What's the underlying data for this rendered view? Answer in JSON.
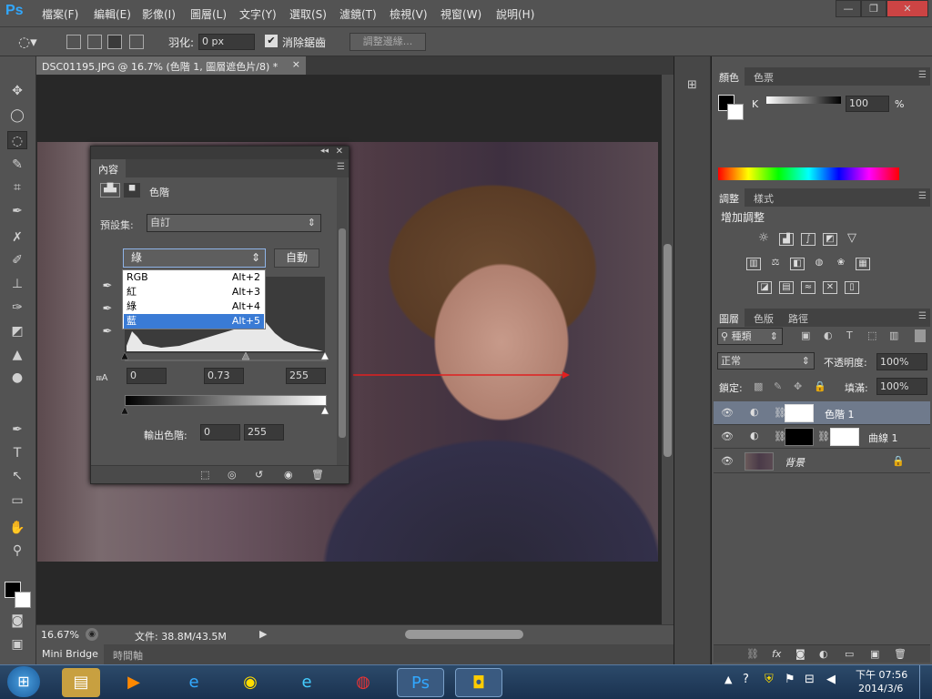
{
  "app": {
    "logo": "Ps",
    "menu": [
      "檔案(F)",
      "編輯(E)",
      "影像(I)",
      "圖層(L)",
      "文字(Y)",
      "選取(S)",
      "濾鏡(T)",
      "檢視(V)",
      "視窗(W)",
      "說明(H)"
    ],
    "window_buttons": [
      "—",
      "❐",
      "✕"
    ]
  },
  "options": {
    "feather_label": "羽化:",
    "feather_value": "0 px",
    "antialias_label": "消除鋸齒",
    "antialias_checked": "✔",
    "refine_edge_button": "調整邊緣..."
  },
  "document": {
    "tab_title": "DSC01195.JPG @ 16.7% (色階 1, 圖層遮色片/8) *",
    "tab_close": "×",
    "zoom": "16.67%",
    "file_info": "文件: 38.8M/43.5M"
  },
  "bottom_tabs": [
    "Mini Bridge",
    "時間軸"
  ],
  "properties": {
    "panel_tab": "內容",
    "title": "色階",
    "preset_label": "預設集:",
    "preset_value": "自訂",
    "channel_value": "綠",
    "auto_button": "自動",
    "channel_options": [
      {
        "label": "RGB",
        "shortcut": "Alt+2"
      },
      {
        "label": "紅",
        "shortcut": "Alt+3"
      },
      {
        "label": "綠",
        "shortcut": "Alt+4"
      },
      {
        "label": "藍",
        "shortcut": "Alt+5"
      }
    ],
    "input_black": "0",
    "input_gamma": "0.73",
    "input_white": "255",
    "output_label": "輸出色階:",
    "output_black": "0",
    "output_white": "255"
  },
  "color_panel": {
    "tabs": [
      "顏色",
      "色票"
    ],
    "channel_label": "K",
    "value": "100",
    "unit": "%"
  },
  "adjustments_panel": {
    "tabs": [
      "調整",
      "樣式"
    ],
    "heading": "增加調整"
  },
  "layers_panel": {
    "tabs": [
      "圖層",
      "色版",
      "路徑"
    ],
    "filter_kind": "種類",
    "blend_mode": "正常",
    "opacity_label": "不透明度:",
    "opacity_value": "100%",
    "lock_label": "鎖定:",
    "fill_label": "填滿:",
    "fill_value": "100%",
    "layers": [
      {
        "name": "色階 1"
      },
      {
        "name": "曲線 1"
      },
      {
        "name": "背景"
      }
    ]
  },
  "taskbar": {
    "time": "下午 07:56",
    "date": "2014/3/6"
  }
}
